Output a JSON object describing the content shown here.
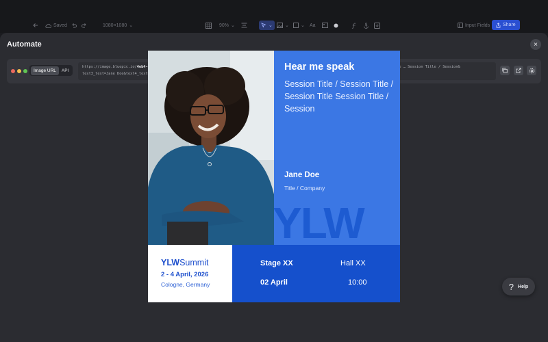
{
  "toolbar": {
    "saved_label": "Saved",
    "canvas_size": "1080×1080",
    "zoom": "90%",
    "text_tool": "Aa",
    "input_fields_label": "Input Fields",
    "share_label": "Share"
  },
  "modal": {
    "title": "Automate",
    "close_label": "×",
    "tabs": [
      "Image URL",
      "API"
    ],
    "active_tab": "Image URL",
    "url_prefix": "https://image.bluepic.io/",
    "url_id": "4eb4-eebd429607fb.png",
    "url_line1_rest": "?image1_image.src=christina-wocintechchat-com-m-S3GrMiUhpNU-unsplash 1.jpeg&text2_text=Session Title … Session Title / Session&",
    "url_line2": "text3_text=Jane Doe&text4_text=Title / Company&text8_text=10:00&text5_text=Stage XX&text6_text=Hall XX&text7_text=02 April"
  },
  "design": {
    "headline": "Hear me speak",
    "session_title": "Session Title / Session Title / Session Title Session Title / Session",
    "speaker_name": "Jane Doe",
    "speaker_role": "Title / Company",
    "brand_watermark": "YLW",
    "logo_bold": "YLW",
    "logo_regular": "Summit",
    "event_dates": "2 - 4 April, 2026",
    "event_city": "Cologne, Germany",
    "stage": "Stage XX",
    "hall": "Hall XX",
    "talk_date": "02 April",
    "talk_time": "10:00"
  },
  "help": {
    "label": "Help",
    "glyph": "?"
  },
  "colors": {
    "accent_blue": "#3b77e4",
    "navy_blue": "#1550cc",
    "share_button": "#2a4fd1",
    "modal_bg": "#2b2c31"
  }
}
